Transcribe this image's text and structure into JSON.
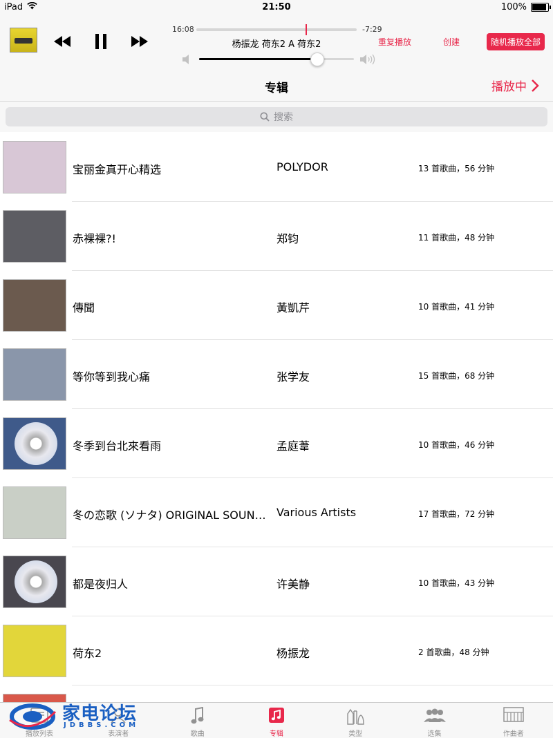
{
  "status": {
    "device": "iPad",
    "time": "21:50",
    "battery": "100%",
    "battery_level": 1.0
  },
  "player": {
    "elapsed": "16:08",
    "remaining": "-7:29",
    "progress": 0.68,
    "now_playing": "杨振龙  荷东2 A  荷东2",
    "repeat_label": "重复播放",
    "create_label": "创建",
    "shuffle_all_label": "随机播放全部",
    "volume": 0.76
  },
  "navbar": {
    "title": "专辑",
    "now_playing_label": "播放中"
  },
  "search": {
    "placeholder": "搜索"
  },
  "albums": [
    {
      "title": "宝丽金真开心精选",
      "artist": "POLYDOR",
      "info": "13 首歌曲，56 分钟",
      "cover_color": "#d8c7d6"
    },
    {
      "title": "赤裸裸?!",
      "artist": "郑钧",
      "info": "11 首歌曲，48 分钟",
      "cover_color": "#5d5d63"
    },
    {
      "title": "傳聞",
      "artist": "黃凱芹",
      "info": "10 首歌曲，41 分钟",
      "cover_color": "#6b5a4e"
    },
    {
      "title": "等你等到我心痛",
      "artist": "张学友",
      "info": "15 首歌曲，68 分钟",
      "cover_color": "#8a96aa"
    },
    {
      "title": "冬季到台北來看雨",
      "artist": "孟庭葦",
      "info": "10 首歌曲，46 分钟",
      "cover_color": "#3f5a8a",
      "disc": true
    },
    {
      "title": "冬の恋歌 (ソナタ) ORIGINAL SOUNDTRACK",
      "artist": "Various Artists",
      "info": "17 首歌曲，72 分钟",
      "cover_color": "#c9cfc6"
    },
    {
      "title": "都是夜归人",
      "artist": "许美静",
      "info": "10 首歌曲，43 分钟",
      "cover_color": "#49474f",
      "disc": true
    },
    {
      "title": "荷东2",
      "artist": "杨振龙",
      "info": "2 首歌曲，48 分钟",
      "cover_color": "#e2d63a"
    },
    {
      "title": "",
      "artist": "",
      "info": "",
      "cover_color": "#d9584a"
    }
  ],
  "tabs": [
    {
      "label": "播放列表",
      "icon": "playlist-icon"
    },
    {
      "label": "表演者",
      "icon": "artist-icon"
    },
    {
      "label": "歌曲",
      "icon": "music-note-icon"
    },
    {
      "label": "专辑",
      "icon": "album-icon",
      "active": true
    },
    {
      "label": "类型",
      "icon": "genre-icon"
    },
    {
      "label": "选集",
      "icon": "compilation-icon"
    },
    {
      "label": "作曲者",
      "icon": "composer-icon"
    }
  ],
  "watermark": {
    "text": "家电论坛",
    "sub": "JDBBS.COM"
  },
  "colors": {
    "accent": "#e8284b",
    "bar_bg": "#f7f7f7",
    "watermark": "#1a5fc2"
  }
}
